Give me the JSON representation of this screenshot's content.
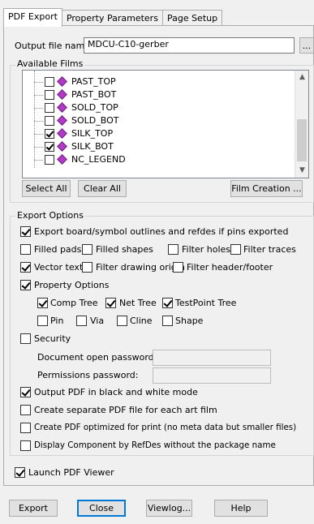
{
  "tabs": [
    "PDF Export",
    "Property Parameters",
    "Page Setup"
  ],
  "output": {
    "label": "Output file name:",
    "value": "MDCU-C10-gerber",
    "browse": "..."
  },
  "films": {
    "title": "Available Films",
    "items": [
      {
        "label": "PAST_TOP",
        "checked": false
      },
      {
        "label": "PAST_BOT",
        "checked": false
      },
      {
        "label": "SOLD_TOP",
        "checked": false
      },
      {
        "label": "SOLD_BOT",
        "checked": false
      },
      {
        "label": "SILK_TOP",
        "checked": true
      },
      {
        "label": "SILK_BOT",
        "checked": true
      },
      {
        "label": "NC_LEGEND",
        "checked": false
      }
    ],
    "select_all": "Select All",
    "clear_all": "Clear All",
    "film_creation": "Film Creation ..."
  },
  "export_options": {
    "title": "Export Options",
    "outlines": {
      "label": "Export board/symbol outlines and refdes if pins exported",
      "checked": true
    },
    "filled_pads": {
      "label": "Filled pads",
      "checked": false
    },
    "filled_shapes": {
      "label": "Filled shapes",
      "checked": false
    },
    "filter_holes": {
      "label": "Filter holes",
      "checked": false
    },
    "filter_traces": {
      "label": "Filter traces",
      "checked": false
    },
    "vector_text": {
      "label": "Vector text",
      "checked": true
    },
    "filter_drawing_origin": {
      "label": "Filter drawing origin",
      "checked": false
    },
    "filter_header_footer": {
      "label": "Filter header/footer",
      "checked": false
    },
    "property_options": {
      "label": "Property Options",
      "checked": true
    },
    "comp_tree": {
      "label": "Comp Tree",
      "checked": true
    },
    "net_tree": {
      "label": "Net Tree",
      "checked": true
    },
    "testpoint_tree": {
      "label": "TestPoint Tree",
      "checked": true
    },
    "pin": {
      "label": "Pin",
      "checked": false
    },
    "via": {
      "label": "Via",
      "checked": false
    },
    "cline": {
      "label": "Cline",
      "checked": false
    },
    "shape": {
      "label": "Shape",
      "checked": false
    },
    "security": {
      "label": "Security",
      "checked": false
    },
    "doc_open_password": "Document open password:",
    "permissions_password": "Permissions password:",
    "black_white": {
      "label": "Output PDF in black and white mode",
      "checked": true
    },
    "separate_pdf": {
      "label": "Create separate PDF file for each art film",
      "checked": false
    },
    "optimized_print": {
      "label": "Create PDF optimized for print (no meta data but smaller files)",
      "checked": false
    },
    "display_refdes": {
      "label": "Display Component by RefDes without the package name",
      "checked": false
    }
  },
  "launch_viewer": {
    "label": "Launch PDF Viewer",
    "checked": true
  },
  "buttons": {
    "export": "Export",
    "close": "Close",
    "viewlog": "Viewlog...",
    "help": "Help"
  }
}
